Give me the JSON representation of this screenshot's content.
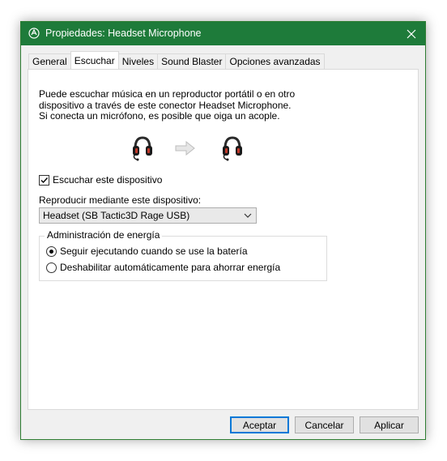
{
  "window": {
    "title": "Propiedades: Headset Microphone",
    "accent_color": "#1e7b3a"
  },
  "tabs": [
    {
      "label": "General"
    },
    {
      "label": "Escuchar",
      "active": true
    },
    {
      "label": "Niveles"
    },
    {
      "label": "Sound Blaster"
    },
    {
      "label": "Opciones avanzadas"
    }
  ],
  "panel": {
    "description": "Puede escuchar música en un reproductor portátil o en otro dispositivo a través de este conector Headset Microphone. Si conecta un micrófono, es posible que oiga un acople.",
    "icons": {
      "source": "headset-icon",
      "arrow": "arrow-right-icon",
      "target": "headset-icon"
    },
    "listen_checkbox": {
      "label": "Escuchar este dispositivo",
      "checked": true
    },
    "playback_label": "Reproducir mediante este dispositivo:",
    "playback_device": "Headset (SB Tactic3D Rage USB)",
    "power": {
      "title": "Administración de energía",
      "options": [
        {
          "label": "Seguir ejecutando cuando se use la batería",
          "checked": true
        },
        {
          "label": "Deshabilitar automáticamente para ahorrar energía",
          "checked": false
        }
      ]
    }
  },
  "buttons": {
    "ok": "Aceptar",
    "cancel": "Cancelar",
    "apply": "Aplicar"
  }
}
